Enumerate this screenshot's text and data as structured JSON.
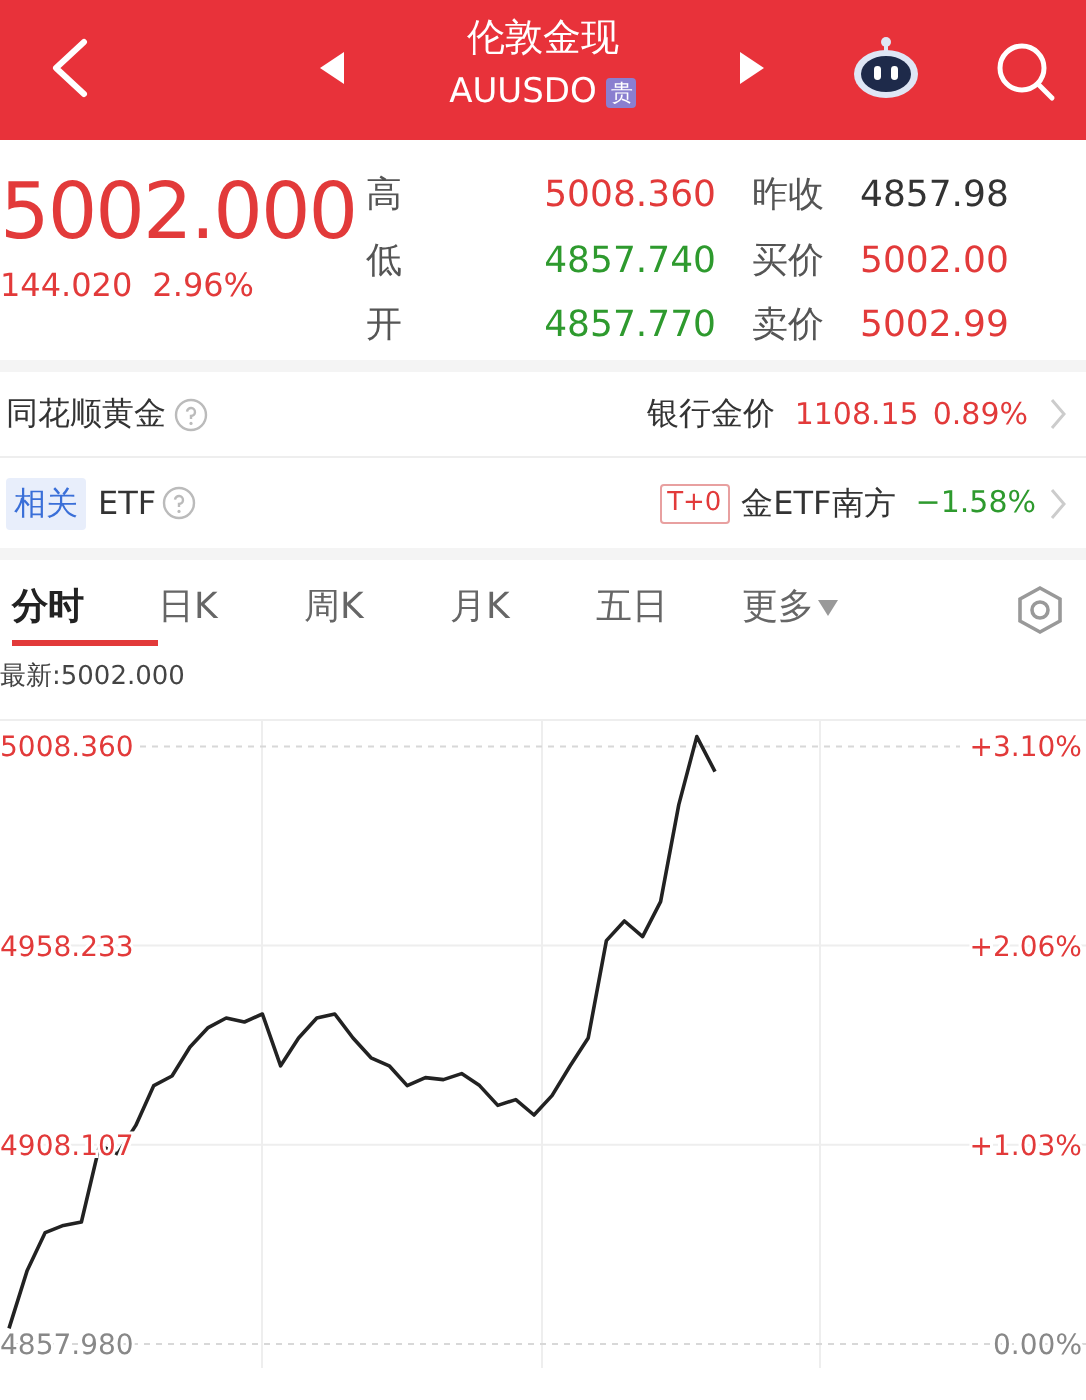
{
  "header": {
    "title": "伦敦金现",
    "subtitle": "AUUSDO",
    "badge": "贵"
  },
  "quote": {
    "price": "5002.000",
    "change": "144.020",
    "change_pct": "2.96%",
    "color": "#e23a3a"
  },
  "stats": [
    {
      "label": "高",
      "value": "5008.360",
      "color": "#e23a3a"
    },
    {
      "label": "昨收",
      "value": "4857.98",
      "color": "#333333"
    },
    {
      "label": "低",
      "value": "4857.740",
      "color": "#2e9a2e"
    },
    {
      "label": "买价",
      "value": "5002.00",
      "color": "#e23a3a"
    },
    {
      "label": "开",
      "value": "4857.770",
      "color": "#2e9a2e"
    },
    {
      "label": "卖价",
      "value": "5002.99",
      "color": "#e23a3a"
    }
  ],
  "gold_row": {
    "label": "同花顺黄金",
    "name": "银行金价",
    "price": "1108.15",
    "change_pct": "0.89%",
    "color": "#e23a3a"
  },
  "etf_row": {
    "tag": "相关",
    "label": "ETF",
    "badge": "T+0",
    "name": "金ETF南方",
    "change_pct": "−1.58%",
    "color": "#2e9a2e"
  },
  "tabs": [
    {
      "label": "分时",
      "selected": true,
      "kind": "plain"
    },
    {
      "label": "日K",
      "selected": false,
      "kind": "plain"
    },
    {
      "label": "周K",
      "selected": false,
      "kind": "plain"
    },
    {
      "label": "月K",
      "selected": false,
      "kind": "plain"
    },
    {
      "label": "五日",
      "selected": false,
      "kind": "plain"
    },
    {
      "label": "更多",
      "selected": false,
      "kind": "dropdown"
    }
  ],
  "chart": {
    "latest": "最新:5002.000",
    "right_labels": [
      "+3.10%",
      "+2.06%",
      "+1.03%",
      "0.00%"
    ],
    "chart_data": {
      "type": "line",
      "grid": true,
      "categories": [
        null,
        null,
        null,
        null,
        null,
        null,
        null,
        null,
        null,
        null,
        null,
        null,
        null,
        null,
        null,
        null,
        null,
        null,
        null,
        null,
        null,
        null,
        null,
        null,
        null,
        null,
        null,
        null,
        null,
        null,
        null,
        null,
        null,
        null,
        null,
        null,
        null,
        null,
        null,
        null,
        null,
        null,
        null,
        null,
        null,
        null,
        null,
        null,
        null,
        null,
        null,
        null,
        null,
        null,
        null,
        null,
        null,
        null,
        null,
        null
      ],
      "ylim": [
        4857.98,
        5015
      ],
      "yticks": [
        {
          "value": 4857.98,
          "label": "4857.980"
        },
        {
          "value": 4908.107,
          "label": "4908.107"
        },
        {
          "value": 4958.233,
          "label": "4958.233"
        },
        {
          "value": 5008.36,
          "label": "5008.360"
        }
      ],
      "series": [
        {
          "color": "#222222",
          "values": [
            4861.9,
            4876.5,
            4886,
            4887.8,
            4888.7,
            4908,
            4905.8,
            4913,
            4923,
            4925.4,
            4932.7,
            4937.6,
            4940,
            4939,
            4941,
            4928,
            4935,
            4940,
            4941,
            4935,
            4930,
            4928,
            4923,
            4925,
            4924.5,
            4926,
            4923,
            4918,
            4919.5,
            4915.6,
            4920.5,
            4928,
            4935,
            4959.5,
            4964.4,
            4960.5,
            4969.3,
            4993.7,
            5010.8,
            5002,
            null,
            null,
            null,
            null,
            null,
            null,
            null,
            null,
            null,
            null,
            null,
            null,
            null,
            null,
            null,
            null,
            null,
            null,
            null,
            null
          ]
        }
      ]
    }
  }
}
